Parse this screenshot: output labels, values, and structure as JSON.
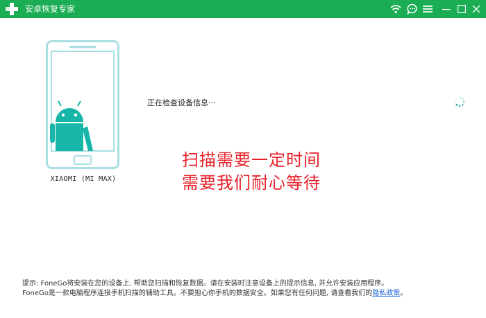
{
  "window": {
    "title": "安卓恢复专家",
    "accent_color": "#1aad54",
    "icons": [
      "plus-logo-icon",
      "wifi-icon",
      "chat-icon",
      "menu-icon",
      "minimize-icon",
      "maximize-icon",
      "close-icon"
    ]
  },
  "device": {
    "name": "XIAOMI (MI MAX)",
    "phone_outline_color": "#a8dfe3",
    "android_color": "#17b6a8"
  },
  "status": {
    "text": "正在检查设备信息···"
  },
  "overlay": {
    "line1": "扫描需要一定时间",
    "line2": "需要我们耐心等待",
    "color": "#e8202a"
  },
  "footer": {
    "hint": "提示: FoneGo将安装在您的设备上, 帮助您扫描和恢复数据。请在安装时注意设备上的提示信息, 并允许安装应用程序。",
    "disclaimer": "FoneGo是一款电脑程序连接手机扫描的辅助工具。不要担心你手机的数据安全。如果您有任何问题, 请查看我们的",
    "privacy_link": "隐私政策",
    "period": "。",
    "link_color": "#1b5fd6"
  }
}
